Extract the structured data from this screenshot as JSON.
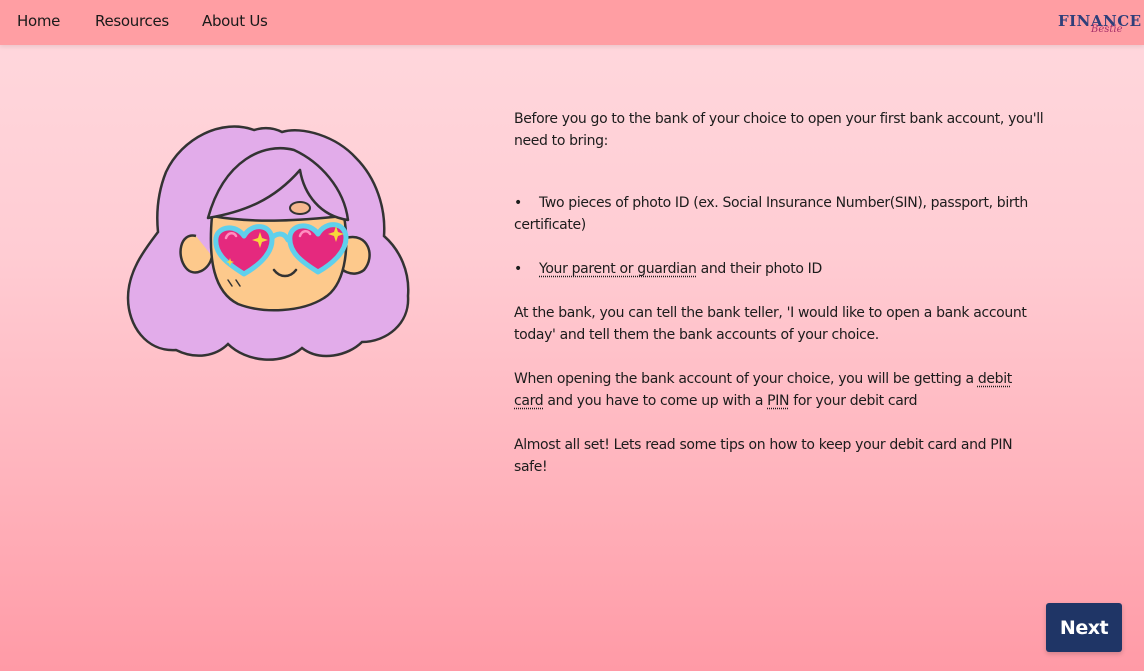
{
  "nav": {
    "items": [
      {
        "label": "Home"
      },
      {
        "label": "Resources"
      },
      {
        "label": "About Us"
      }
    ],
    "logo": {
      "main": "FINANCE",
      "sub": "Bestie"
    }
  },
  "illustration": {
    "icon": "girl-with-heart-glasses-icon",
    "colors": {
      "hair": "#e2acea",
      "skin": "#fdc98c",
      "heart_lenses": "#e5297e",
      "glasses_frame": "#60d0ec",
      "sparkles": "#f7d83a"
    }
  },
  "content": {
    "intro": "Before you go to the bank of your choice to open your first bank account, you'll need to bring:",
    "bullets": [
      {
        "text": "Two pieces of photo ID (ex. Social Insurance Number(SIN), passport, birth certificate)"
      },
      {
        "link": "Your parent or guardian",
        "rest": " and their photo ID"
      }
    ],
    "teller_para": "At the bank, you can tell the bank teller, 'I would like to open a bank account today' and tell them the bank accounts of your choice.",
    "debit_para": {
      "pre": "When opening the bank account of your choice, you will be getting a ",
      "link1": "debit card",
      "mid": " and you have to come up with a ",
      "link2": "PIN",
      "post": " for your debit card"
    },
    "closing": "Almost all set! Lets read some tips on how to keep your debit card and PIN safe!"
  },
  "next_button": {
    "label": "Next"
  },
  "colors": {
    "navbar": "#ff9ea3",
    "button": "#1f3566",
    "logo_main": "#2f3f7a",
    "logo_sub": "#a8326b"
  }
}
